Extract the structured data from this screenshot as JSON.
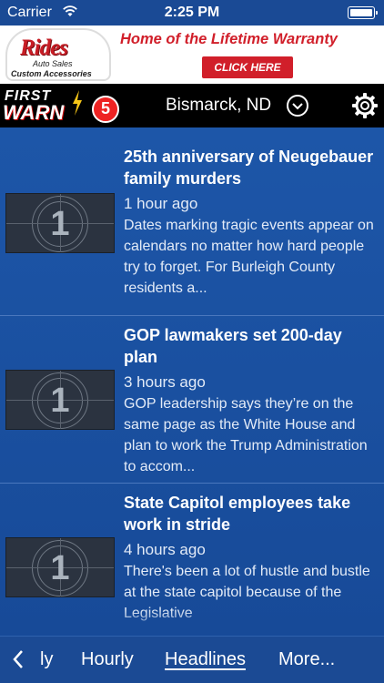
{
  "status_bar": {
    "carrier": "Carrier",
    "time": "2:25 PM"
  },
  "ad": {
    "brand": "Rides",
    "brand_sub1": "Auto Sales",
    "brand_sub2": "Custom Accessories",
    "headline": "Home of the Lifetime Warranty",
    "cta": "CLICK HERE",
    "brand_color": "#d11f2a"
  },
  "header": {
    "logo_line1": "FIRST",
    "logo_line2": "WARN",
    "logo_badge": "5",
    "location": "Bismarck, ND",
    "settings_icon": "gear-icon"
  },
  "news": [
    {
      "thumb_number": "1",
      "title": "25th anniversary of Neugebauer family murders",
      "time": "1 hour ago",
      "summary": "Dates marking tragic events appear on calendars no matter how hard people try to forget. For Burleigh County residents a..."
    },
    {
      "thumb_number": "1",
      "title": "GOP lawmakers set 200-day plan",
      "time": "3 hours ago",
      "summary": "GOP leadership says they’re on the same page as the White House and plan to work the Trump Administration to accom..."
    },
    {
      "thumb_number": "1",
      "title": "State Capitol employees take work in stride",
      "time": "4 hours ago",
      "summary": "There's been a lot of hustle and bustle at the state capitol because of the Legislative"
    }
  ],
  "bottom_nav": {
    "items": [
      {
        "label": "ly"
      },
      {
        "label": "Hourly"
      },
      {
        "label": "Headlines"
      },
      {
        "label": "More..."
      }
    ],
    "active": "Headlines",
    "accent": "#1b4a94"
  }
}
